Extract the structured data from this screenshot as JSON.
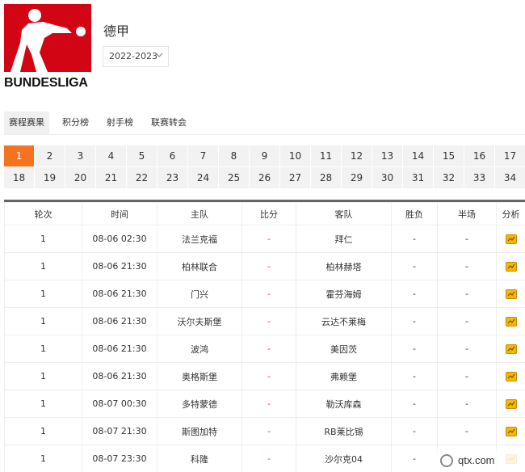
{
  "header": {
    "logo_text": "BUNDESLIGA",
    "league_name": "德甲",
    "season": "2022-2023"
  },
  "tabs": [
    {
      "label": "赛程赛果",
      "active": true
    },
    {
      "label": "积分榜",
      "active": false
    },
    {
      "label": "射手榜",
      "active": false
    },
    {
      "label": "联赛转会",
      "active": false
    }
  ],
  "rounds": [
    "1",
    "2",
    "3",
    "4",
    "5",
    "6",
    "7",
    "8",
    "9",
    "10",
    "11",
    "12",
    "13",
    "14",
    "15",
    "16",
    "17",
    "18",
    "19",
    "20",
    "21",
    "22",
    "23",
    "24",
    "25",
    "26",
    "27",
    "28",
    "29",
    "30",
    "31",
    "32",
    "33",
    "34"
  ],
  "active_round": "1",
  "table": {
    "headers": [
      "轮次",
      "时间",
      "主队",
      "比分",
      "客队",
      "胜负",
      "半场",
      "分析"
    ],
    "rows": [
      {
        "round": "1",
        "time": "08-06 02:30",
        "home": "法兰克福",
        "score": "-",
        "away": "拜仁",
        "result": "-",
        "half": "-"
      },
      {
        "round": "1",
        "time": "08-06 21:30",
        "home": "柏林联合",
        "score": "-",
        "away": "柏林赫塔",
        "result": "-",
        "half": "-"
      },
      {
        "round": "1",
        "time": "08-06 21:30",
        "home": "门兴",
        "score": "-",
        "away": "霍芬海姆",
        "result": "-",
        "half": "-"
      },
      {
        "round": "1",
        "time": "08-06 21:30",
        "home": "沃尔夫斯堡",
        "score": "-",
        "away": "云达不莱梅",
        "result": "-",
        "half": "-"
      },
      {
        "round": "1",
        "time": "08-06 21:30",
        "home": "波鸿",
        "score": "-",
        "away": "美因茨",
        "result": "-",
        "half": "-"
      },
      {
        "round": "1",
        "time": "08-06 21:30",
        "home": "奥格斯堡",
        "score": "-",
        "away": "弗赖堡",
        "result": "-",
        "half": "-"
      },
      {
        "round": "1",
        "time": "08-07 00:30",
        "home": "多特蒙德",
        "score": "-",
        "away": "勒沃库森",
        "result": "-",
        "half": "-"
      },
      {
        "round": "1",
        "time": "08-07 21:30",
        "home": "斯图加特",
        "score": "-",
        "away": "RB莱比锡",
        "result": "-",
        "half": "-"
      },
      {
        "round": "1",
        "time": "08-07 23:30",
        "home": "科隆",
        "score": "-",
        "away": "沙尔克04",
        "result": "-",
        "half": "-"
      }
    ]
  },
  "watermark": "qtx.com",
  "colors": {
    "brand_red": "#d20515",
    "active_round": "#f37321",
    "score_red": "#e33333",
    "analysis_icon": "#f5b800"
  },
  "icons": {
    "season_dropdown": "chevron-down-icon",
    "analysis": "analysis-chart-icon",
    "logo": "bundesliga-player-logo"
  }
}
